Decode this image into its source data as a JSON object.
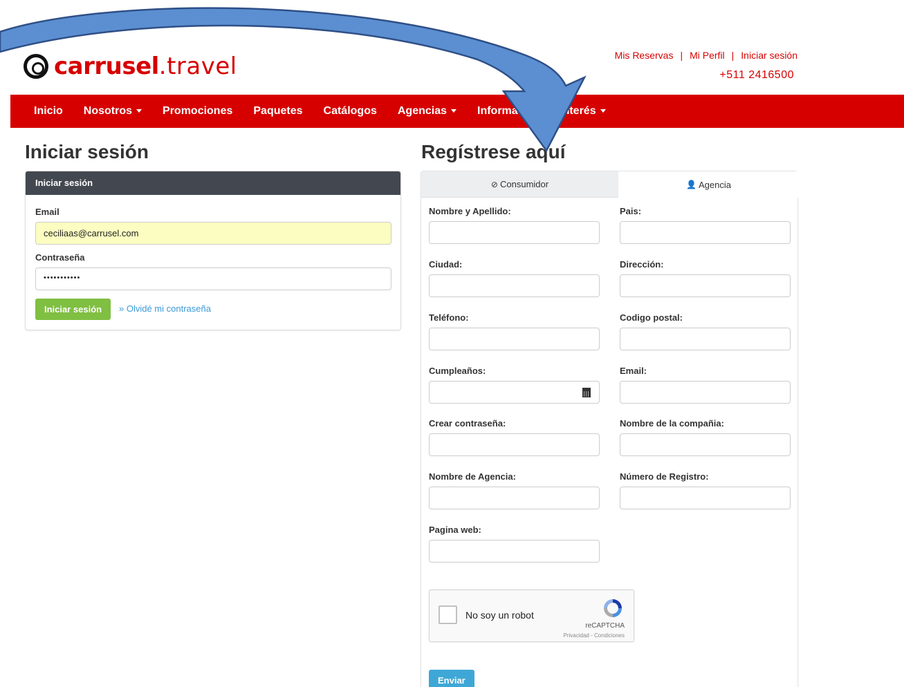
{
  "header": {
    "logo_bold": "carrusel",
    "logo_light": ".travel",
    "links": [
      "Mis Reservas",
      "Mi Perfil",
      "Iniciar sesión"
    ],
    "separator": "|",
    "phone": "+511 2416500"
  },
  "nav": {
    "items": [
      {
        "label": "Inicio",
        "dropdown": false
      },
      {
        "label": "Nosotros",
        "dropdown": true
      },
      {
        "label": "Promociones",
        "dropdown": false
      },
      {
        "label": "Paquetes",
        "dropdown": false
      },
      {
        "label": "Catálogos",
        "dropdown": false
      },
      {
        "label": "Agencias",
        "dropdown": true
      },
      {
        "label": "Información de Interés",
        "dropdown": true
      }
    ]
  },
  "login": {
    "title": "Iniciar sesión",
    "panel_title": "Iniciar sesión",
    "email_label": "Email",
    "email_value": "ceciliaas@carrusel.com",
    "password_label": "Contraseña",
    "password_value": "•••••••••••",
    "submit_label": "Iniciar sesión",
    "forgot_label": "» Olvidé mi contraseña"
  },
  "register": {
    "title": "Regístrese aquí",
    "tabs": [
      {
        "icon": "check-circle-icon",
        "label": "Consumidor"
      },
      {
        "icon": "user-icon",
        "label": "Agencia"
      }
    ],
    "fields": {
      "name": "Nombre y Apellido:",
      "country": "Pais:",
      "city": "Ciudad:",
      "address": "Dirección:",
      "phone": "Teléfono:",
      "postal": "Codigo postal:",
      "birthday": "Cumpleaños:",
      "email": "Email:",
      "password": "Crear contraseña:",
      "company": "Nombre de la compañia:",
      "agency": "Nombre de Agencia:",
      "registry": "Número de Registro:",
      "website": "Pagina web:"
    },
    "captcha": {
      "label": "No soy un robot",
      "brand": "reCAPTCHA",
      "links": "Privacidad - Condiciones"
    },
    "submit_label": "Enviar"
  },
  "colors": {
    "brand_red": "#d60000",
    "panel_header": "#434850",
    "green_button": "#7fbf42",
    "blue_button": "#3fa7d6",
    "arrow_blue": "#5b8fd1"
  }
}
